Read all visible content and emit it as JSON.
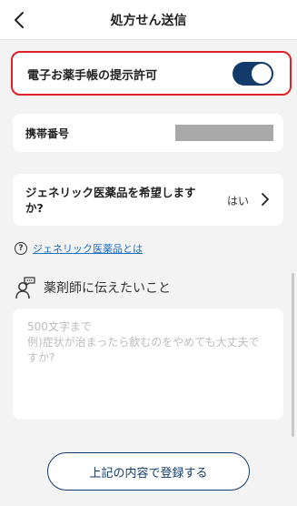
{
  "header": {
    "title": "処方せん送信",
    "back_icon": "chevron-left-icon"
  },
  "e_notebook": {
    "label": "電子お薬手帳の提示許可",
    "enabled": true,
    "toggle_color": "#123b6b",
    "highlight_color": "#e0202a"
  },
  "phone": {
    "label": "携帯番号",
    "value_redacted": true
  },
  "generic": {
    "label": "ジェネリック医薬品を希望しますか?",
    "value": "はい"
  },
  "help": {
    "icon": "question-circle-icon",
    "link_text": "ジェネリック医薬品とは"
  },
  "pharmacist": {
    "icon": "pharmacist-chat-icon",
    "label": "薬剤師に伝えたいこと",
    "placeholder": "500文字まで\n例)症状が治まったら飲むのをやめても大丈夫ですか?"
  },
  "submit": {
    "label": "上記の内容で登録する"
  }
}
